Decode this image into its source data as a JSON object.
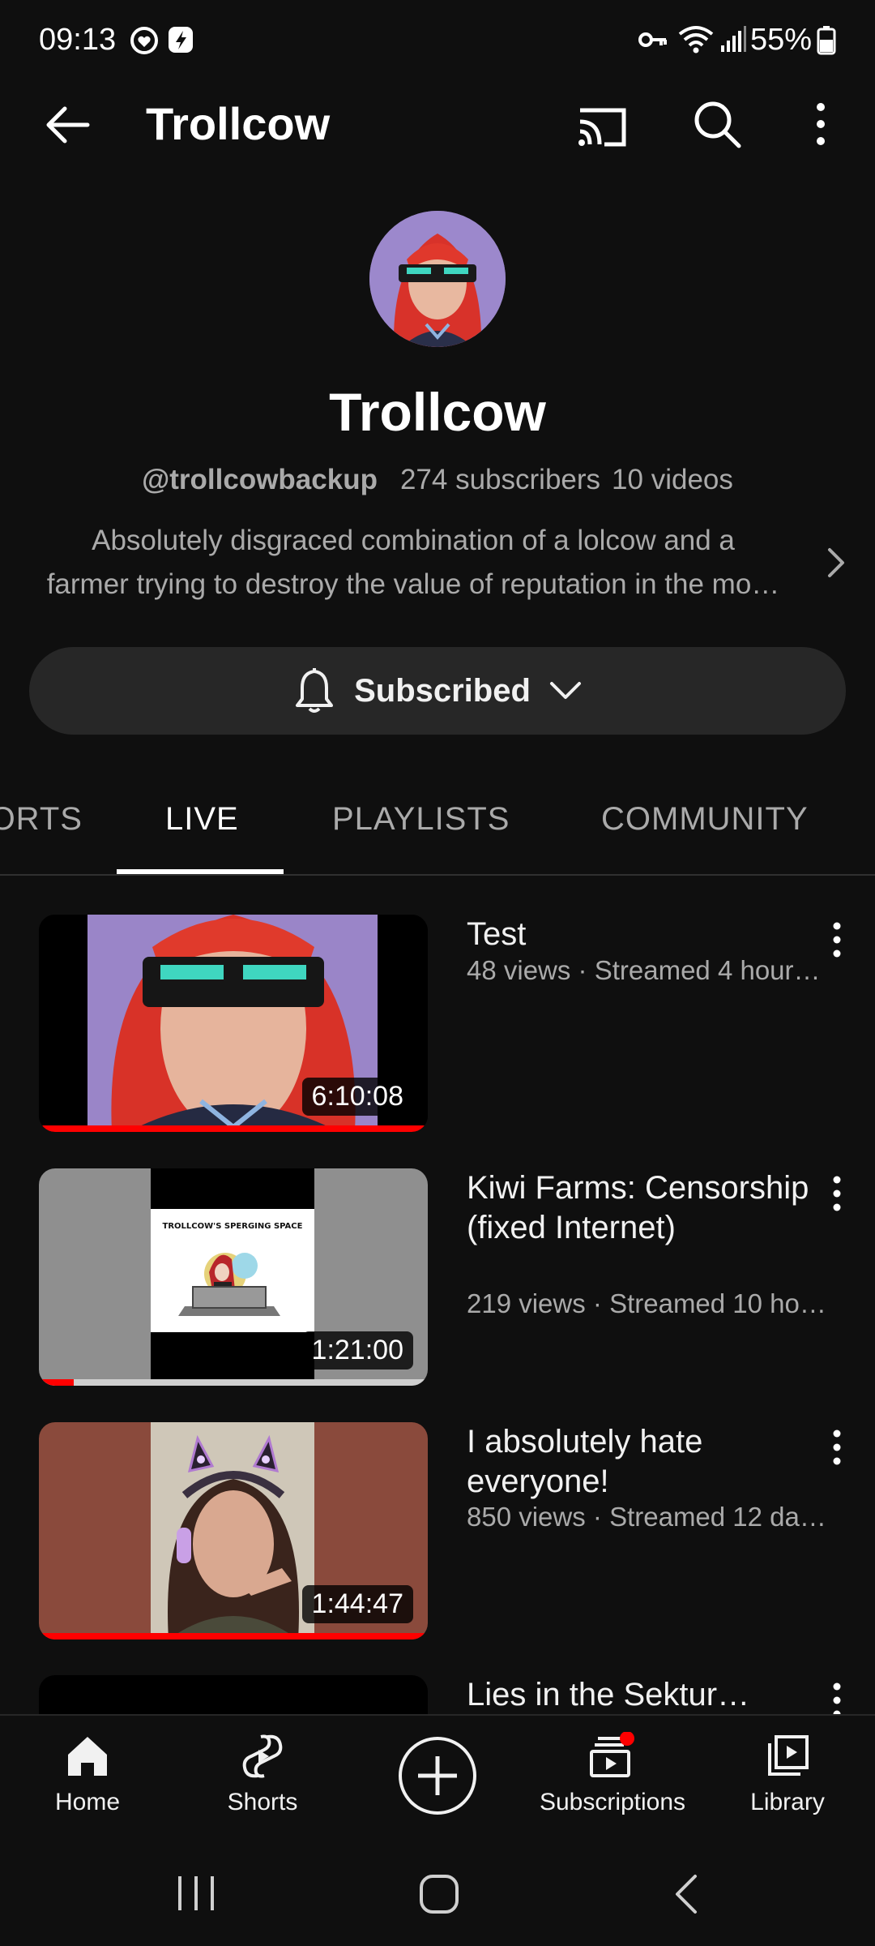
{
  "status_bar": {
    "time": "09:13",
    "battery": "55%"
  },
  "top_bar": {
    "title": "Trollcow"
  },
  "channel": {
    "name": "Trollcow",
    "handle": "@trollcowbackup",
    "subscribers": "274 subscribers",
    "videos": "10 videos",
    "description_line1": "Absolutely disgraced combination of a lolcow and a",
    "description_line2": "farmer trying to destroy the value of reputation in the mo…",
    "subscribe_label": "Subscribed"
  },
  "tabs": [
    {
      "label": "SHORTS"
    },
    {
      "label": "LIVE",
      "active": true
    },
    {
      "label": "PLAYLISTS"
    },
    {
      "label": "COMMUNITY"
    }
  ],
  "videos": [
    {
      "title": "Test",
      "meta": "48 views · Streamed 4 hour…",
      "duration": "6:10:08",
      "watched_fraction": 1.0
    },
    {
      "title": "Kiwi Farms: Censorship (fixed Internet)",
      "meta": "219 views · Streamed 10 ho…",
      "duration": "1:21:00",
      "watched_fraction": 0.09,
      "thumb_text": "TROLLCOW'S SPERGING SPACE"
    },
    {
      "title": "I absolutely hate everyone!",
      "meta": "850 views · Streamed 12 da…",
      "duration": "1:44:47",
      "watched_fraction": 1.0
    },
    {
      "title": "Lies in the Sektur…"
    }
  ],
  "bottom_nav": {
    "home": "Home",
    "shorts": "Shorts",
    "subscriptions": "Subscriptions",
    "library": "Library"
  },
  "colors": {
    "background": "#0f0f0f",
    "accent_red": "#ff0000",
    "chip": "#272727",
    "secondary_text": "#aaaaaa"
  }
}
